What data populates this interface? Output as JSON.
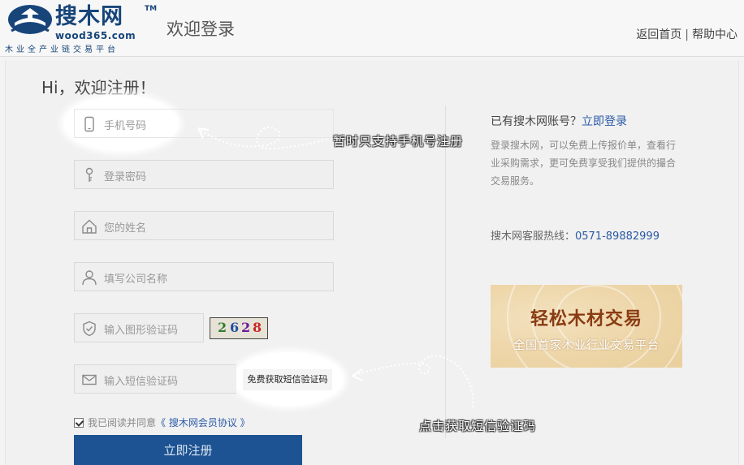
{
  "header": {
    "logo_text": "搜木网",
    "logo_tm": "TM",
    "logo_url": "wood365.com",
    "logo_slogan": "木业全产业链交易平台",
    "page_heading": "欢迎登录",
    "home_link": "返回首页",
    "separator": "|",
    "help_link": "帮助中心"
  },
  "form": {
    "greeting": "Hi，欢迎注册！",
    "phone_placeholder": "手机号码",
    "password_placeholder": "登录密码",
    "name_placeholder": "您的姓名",
    "company_placeholder": "填写公司名称",
    "captcha_placeholder": "输入图形验证码",
    "captcha_digits": [
      "2",
      "6",
      "2",
      "8"
    ],
    "sms_placeholder": "输入短信验证码",
    "sms_button": "免费获取短信验证码",
    "agree_text": "我已阅读并同意",
    "agree_link": "《 搜木网会员协议 》",
    "agree_checked": true,
    "submit_label": "立即注册"
  },
  "side": {
    "has_account": "已有搜木网账号？",
    "login_link": "立即登录",
    "description": "登录搜木网，可以免费上传报价单，查看行业采购需求，更可免费享受我们提供的撮合交易服务。",
    "hotline_label": "搜木网客服热线：",
    "hotline_number": "0571-89882999",
    "banner_title": "轻松木材交易",
    "banner_subtitle": "全国首家木业行业交易平台"
  },
  "annotations": {
    "phone_note": "暂时只支持手机号注册",
    "sms_note": "点击获取短信验证码"
  },
  "colors": {
    "brand_blue": "#17457a",
    "link_blue": "#2a5aa6",
    "submit_bg": "#1d5392",
    "banner_text": "#8a3b12"
  },
  "icons": {
    "phone": "mobile-phone-icon",
    "password": "key-icon",
    "name": "house-icon",
    "company": "user-icon",
    "captcha": "shield-check-icon",
    "sms": "envelope-icon"
  }
}
